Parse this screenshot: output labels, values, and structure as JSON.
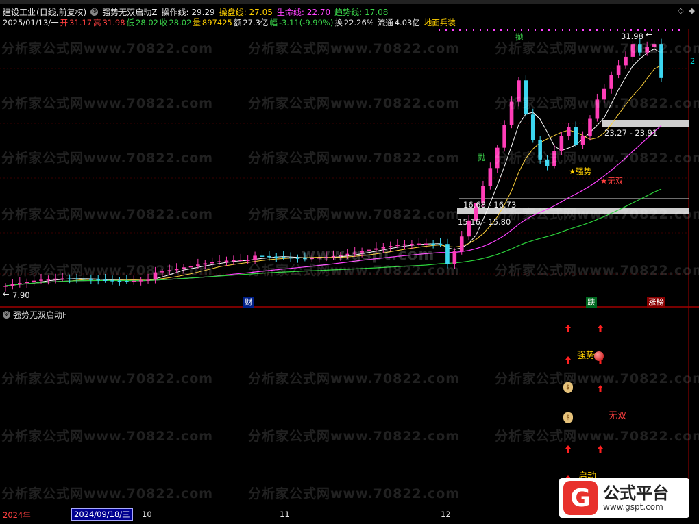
{
  "header": {
    "stock_name": "建设工业",
    "period": "(日线,前复权)",
    "indicator_name": "强势无双启动Z",
    "op_label": "操作线:",
    "op_value": "29.29",
    "pan_label": "操盘线:",
    "pan_value": "27.05",
    "life_label": "生命线:",
    "life_value": "22.70",
    "trend_label": "趋势线:",
    "trend_value": "17.08"
  },
  "quote": {
    "date": "2025/01/13/一",
    "open_label": "开",
    "open": "31.17",
    "high_label": "高",
    "high": "31.98",
    "low_label": "低",
    "low": "28.02",
    "close_label": "收",
    "close": "28.02",
    "vol_label": "量",
    "vol": "897425",
    "amt_label": "额",
    "amt": "27.3亿",
    "chg_label": "幅",
    "chg": "-3.11(-9.99%)",
    "turn_label": "换",
    "turn": "22.26%",
    "float_label": "流通",
    "float": "4.03亿",
    "sector": "地面兵装"
  },
  "main_chart": {
    "max_price_label": "31.98",
    "min_price_label": "7.90",
    "zone_upper": "23.27 - 23.91",
    "zone_mid": "16.68 - 16.73",
    "zone_low": "15.16 - 15.80",
    "sig_pao": "抛",
    "sig_qiangshi": "★强势",
    "sig_wushuang": "★无双",
    "right_num": "2",
    "bottom_cai": "财",
    "bottom_die": "跌",
    "bottom_zhangbang": "涨榜",
    "watermark": "分析家公式网www.70822.com",
    "watermark2": "www.gspt.com"
  },
  "sub_chart": {
    "title": "强势无双启动F",
    "label_qiangshi": "强势",
    "label_wushuang": "无双",
    "label_qidong": "启动"
  },
  "date_axis": {
    "year": "2024年",
    "selected_date": "2024/09/18/三",
    "m10": "10",
    "m11": "11",
    "m12": "12"
  },
  "logo": {
    "mark": "G",
    "name": "公式平台",
    "url": "www.gspt.com"
  },
  "colors": {
    "up": "#ff3db8",
    "down": "#3cd6f0",
    "ma_op": "#ffffff",
    "ma_pan": "#ffd23a",
    "ma_life": "#ff40ff",
    "ma_trend": "#2bd43b"
  }
}
